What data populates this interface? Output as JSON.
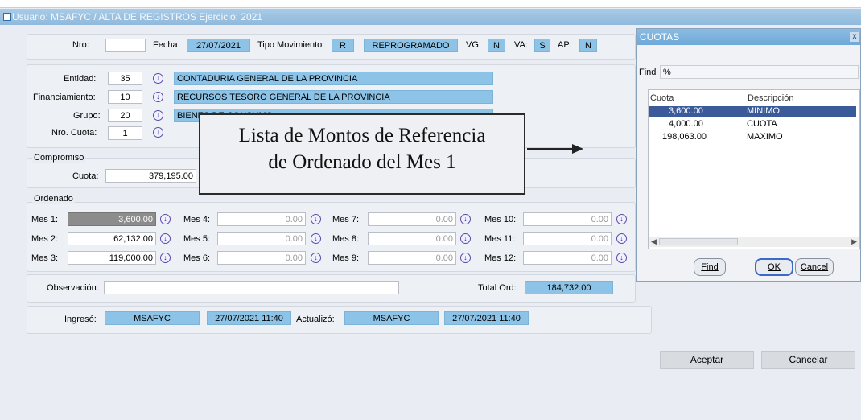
{
  "window": {
    "title": "Usuario: MSAFYC  /  ALTA DE REGISTROS  Ejercicio: 2021"
  },
  "header": {
    "nro_label": "Nro:",
    "nro_value": "",
    "fecha_label": "Fecha:",
    "fecha_value": "27/07/2021",
    "tipo_label": "Tipo Movimiento:",
    "tipo_code": "R",
    "tipo_desc": "REPROGRAMADO",
    "vg_label": "VG:",
    "vg_value": "N",
    "va_label": "VA:",
    "va_value": "S",
    "ap_label": "AP:",
    "ap_value": "N"
  },
  "entity": {
    "entidad_label": "Entidad:",
    "entidad_code": "35",
    "entidad_desc": "CONTADURIA GENERAL DE LA PROVINCIA",
    "fin_label": "Financiamiento:",
    "fin_code": "10",
    "fin_desc": "RECURSOS TESORO GENERAL DE LA PROVINCIA",
    "grupo_label": "Grupo:",
    "grupo_code": "20",
    "grupo_desc": "BIENES DE CONSUMO",
    "cuota_label": "Nro. Cuota:",
    "cuota_value": "1"
  },
  "compromiso": {
    "section": "Compromiso",
    "cuota_label": "Cuota:",
    "cuota_value": "379,195.00"
  },
  "ordenado": {
    "section": "Ordenado",
    "months": [
      {
        "label": "Mes 1:",
        "value": "3,600.00"
      },
      {
        "label": "Mes 2:",
        "value": "62,132.00"
      },
      {
        "label": "Mes 3:",
        "value": "119,000.00"
      },
      {
        "label": "Mes 4:",
        "value": "0.00"
      },
      {
        "label": "Mes 5:",
        "value": "0.00"
      },
      {
        "label": "Mes 6:",
        "value": "0.00"
      },
      {
        "label": "Mes 7:",
        "value": "0.00"
      },
      {
        "label": "Mes 8:",
        "value": "0.00"
      },
      {
        "label": "Mes 9:",
        "value": "0.00"
      },
      {
        "label": "Mes 10:",
        "value": "0.00"
      },
      {
        "label": "Mes 11:",
        "value": "0.00"
      },
      {
        "label": "Mes 12:",
        "value": "0.00"
      }
    ]
  },
  "observacion": {
    "label": "Observación:",
    "value": "",
    "total_label": "Total Ord:",
    "total_value": "184,732.00"
  },
  "audit": {
    "ingreso_label": "Ingresó:",
    "ingreso_user": "MSAFYC",
    "ingreso_date": "27/07/2021 11:40",
    "actualizo_label": "Actualizó:",
    "actualizo_user": "MSAFYC",
    "actualizo_date": "27/07/2021 11:40"
  },
  "callout": {
    "line1": "Lista de Montos de Referencia",
    "line2": "de Ordenado del Mes 1"
  },
  "buttons": {
    "aceptar": "Aceptar",
    "cancelar": "Cancelar"
  },
  "lov_dialog": {
    "title": "CUOTAS",
    "close": "x",
    "find_label": "Find",
    "find_value": "%",
    "columns": [
      "Cuota",
      "Descripción"
    ],
    "rows": [
      {
        "cuota": "3,600.00",
        "desc": "MINIMO"
      },
      {
        "cuota": "4,000.00",
        "desc": "CUOTA"
      },
      {
        "cuota": "198,063.00",
        "desc": "MAXIMO"
      }
    ],
    "selected_index": 0,
    "btn_find": "Find",
    "btn_ok": "OK",
    "btn_cancel": "Cancel"
  },
  "icons": {
    "lov": "down-arrow-circle-icon"
  },
  "colors": {
    "field_blue": "#8dc3e6",
    "title_blue": "#8fb9dd",
    "selection": "#3b5a9a"
  }
}
